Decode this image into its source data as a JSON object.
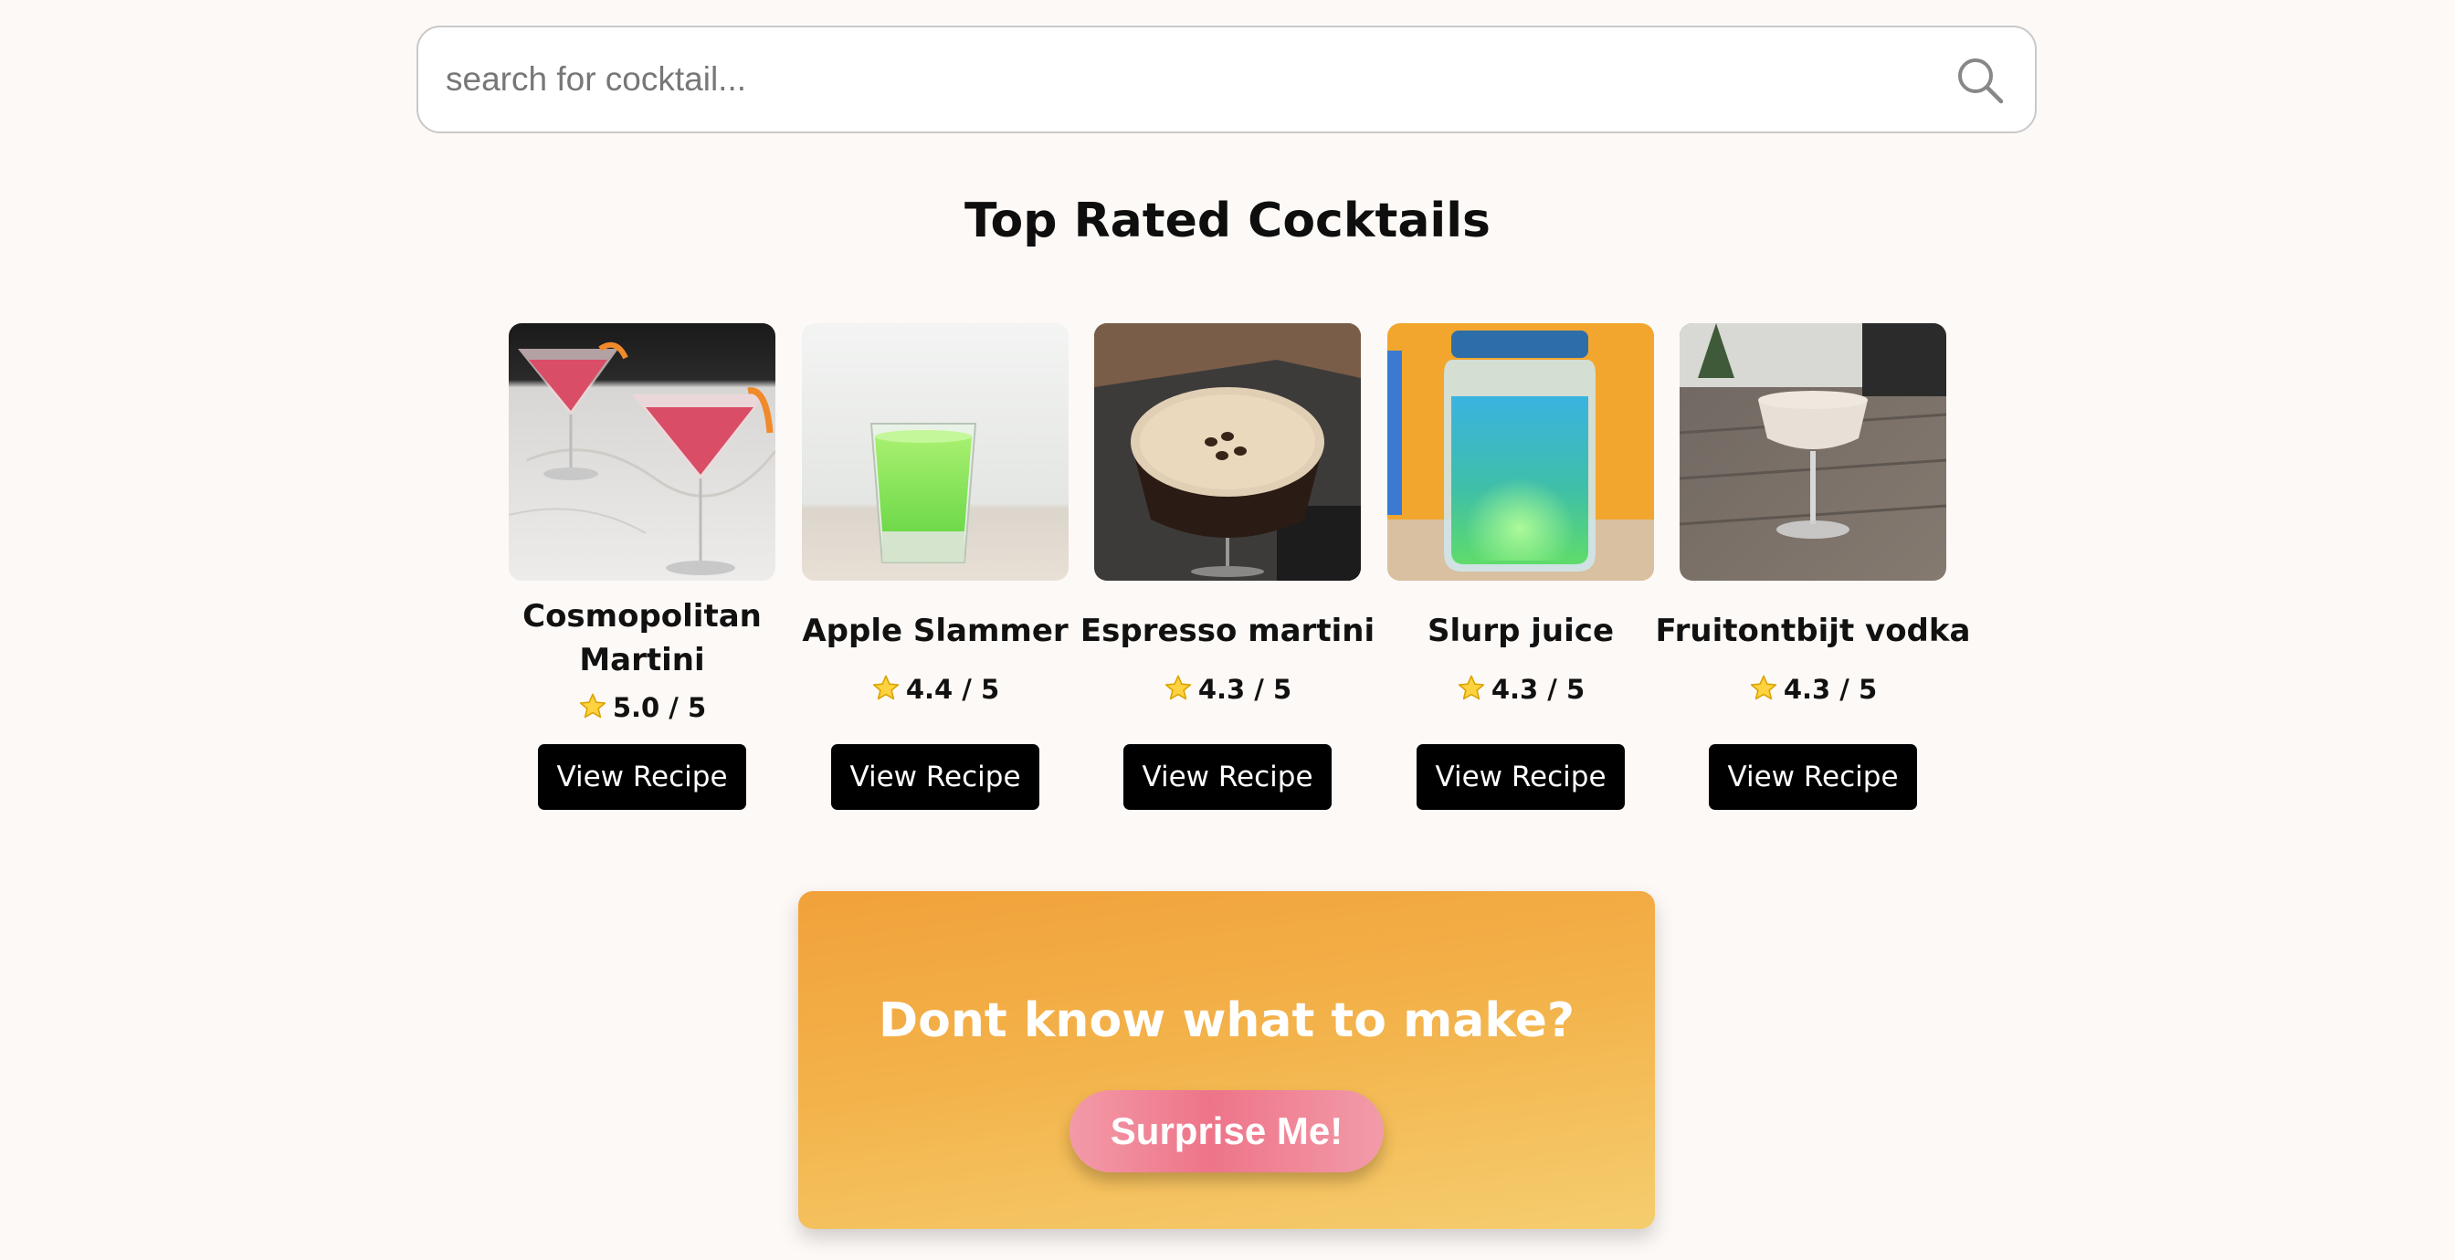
{
  "search": {
    "placeholder": "search for cocktail...",
    "value": ""
  },
  "section_title": "Top Rated Cocktails",
  "cocktails": [
    {
      "name": "Cosmopolitan Martini",
      "rating": "5.0 / 5",
      "button_label": "View Recipe"
    },
    {
      "name": "Apple Slammer",
      "rating": "4.4 / 5",
      "button_label": "View Recipe"
    },
    {
      "name": "Espresso martini",
      "rating": "4.3 / 5",
      "button_label": "View Recipe"
    },
    {
      "name": "Slurp juice",
      "rating": "4.3 / 5",
      "button_label": "View Recipe"
    },
    {
      "name": "Fruitontbijt vodka",
      "rating": "4.3 / 5",
      "button_label": "View Recipe"
    }
  ],
  "surprise": {
    "heading": "Dont know what to make?",
    "button_label": "Surprise Me!"
  },
  "icons": {
    "search": "search-icon",
    "star": "star-icon"
  },
  "colors": {
    "page_background": "#fdf9f6",
    "button_background": "#000000",
    "panel_gradient_top": "#f2a13a",
    "panel_gradient_bottom": "#f5cd6e",
    "surprise_button": "#ee7489"
  }
}
